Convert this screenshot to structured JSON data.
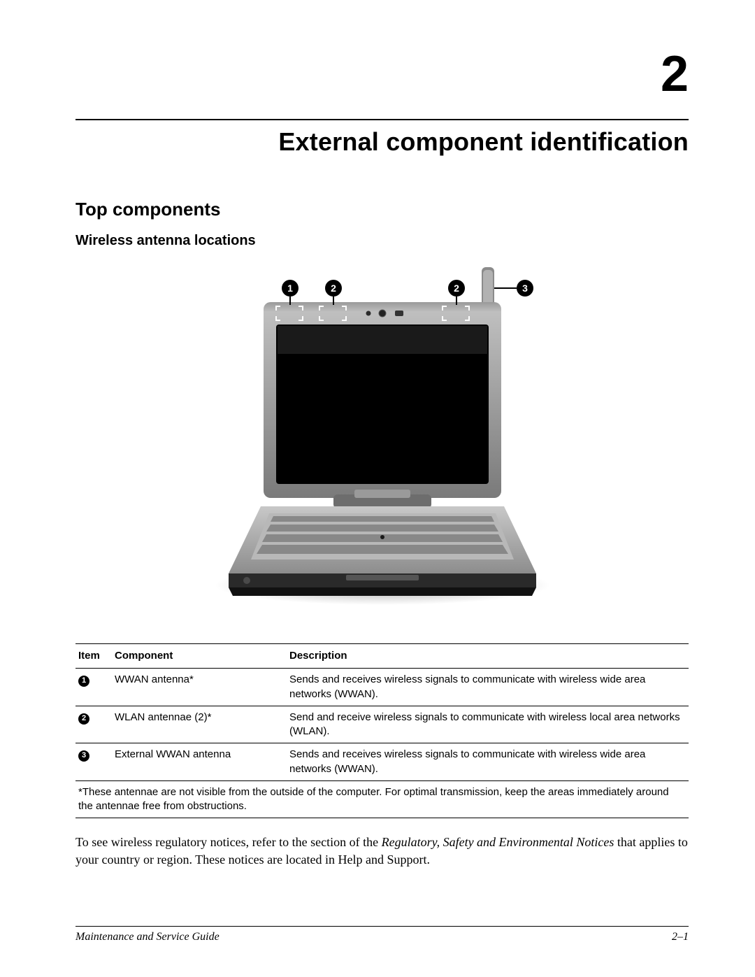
{
  "chapter": {
    "number": "2",
    "title": "External component identification"
  },
  "section": {
    "title": "Top components"
  },
  "subsection": {
    "title": "Wireless antenna locations"
  },
  "callouts": {
    "c1": "1",
    "c2": "2",
    "c3": "2",
    "c4": "3"
  },
  "table": {
    "headers": {
      "item": "Item",
      "component": "Component",
      "description": "Description"
    },
    "rows": [
      {
        "num": "1",
        "component": "WWAN antenna*",
        "description": "Sends and receives wireless signals to communicate with wireless wide area networks (WWAN)."
      },
      {
        "num": "2",
        "component": "WLAN antennae (2)*",
        "description": "Send and receive wireless signals to communicate with wireless local area networks (WLAN)."
      },
      {
        "num": "3",
        "component": "External WWAN antenna",
        "description": "Sends and receives wireless signals to communicate with wireless wide area networks (WWAN)."
      }
    ],
    "footnote": "*These antennae are not visible from the outside of the computer. For optimal transmission, keep the areas immediately around the antennae free from obstructions."
  },
  "paragraph": {
    "pre": "To see wireless regulatory notices, refer to the section of the ",
    "ital": "Regulatory, Safety and Environmental Notices",
    "post": " that applies to your country or region. These notices are located in Help and Support."
  },
  "footer": {
    "left": "Maintenance and Service Guide",
    "right": "2–1"
  }
}
